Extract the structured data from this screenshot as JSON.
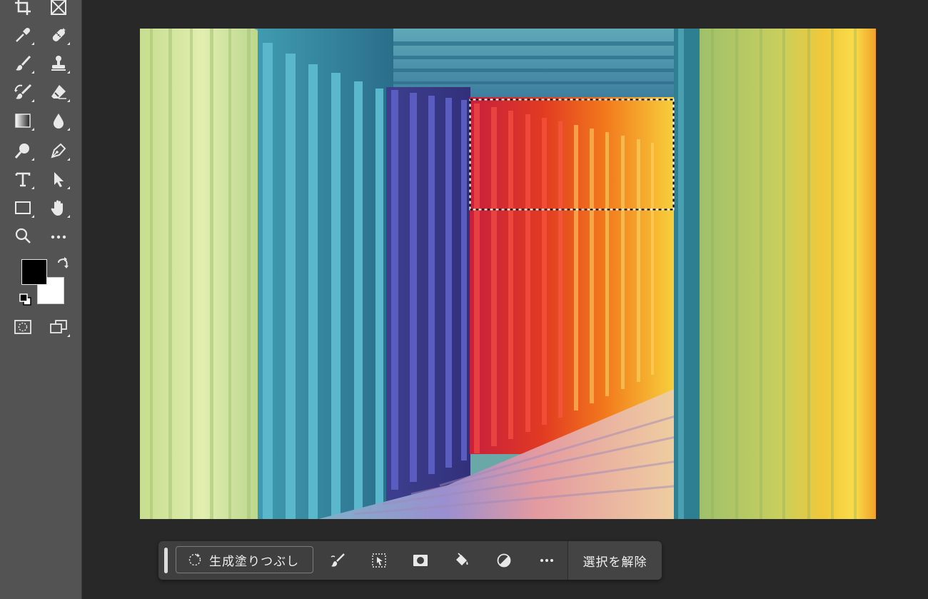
{
  "tools": [
    {
      "name": "crop-tool",
      "icon": "crop-icon"
    },
    {
      "name": "frame-tool",
      "icon": "frame-icon"
    },
    {
      "name": "eyedropper-tool",
      "icon": "eyedropper-icon"
    },
    {
      "name": "spot-healing-tool",
      "icon": "bandage-icon"
    },
    {
      "name": "brush-tool",
      "icon": "brush-icon"
    },
    {
      "name": "clone-stamp-tool",
      "icon": "stamp-icon"
    },
    {
      "name": "history-brush-tool",
      "icon": "history-brush-icon"
    },
    {
      "name": "eraser-tool",
      "icon": "eraser-icon"
    },
    {
      "name": "gradient-tool",
      "icon": "gradient-icon"
    },
    {
      "name": "blur-tool",
      "icon": "drop-icon"
    },
    {
      "name": "dodge-tool",
      "icon": "dodge-icon"
    },
    {
      "name": "pen-tool",
      "icon": "pen-icon"
    },
    {
      "name": "type-tool",
      "icon": "type-icon"
    },
    {
      "name": "path-selection-tool",
      "icon": "arrow-icon"
    },
    {
      "name": "rectangle-tool",
      "icon": "rectangle-icon"
    },
    {
      "name": "hand-tool",
      "icon": "hand-icon"
    },
    {
      "name": "zoom-tool",
      "icon": "magnifier-icon"
    },
    {
      "name": "edit-toolbar",
      "icon": "more-icon"
    }
  ],
  "colors": {
    "foreground": "#000000",
    "background": "#ffffff",
    "toolbar_bg": "#535353",
    "workspace_bg": "#282828",
    "taskbar_bg": "#3f3f3f"
  },
  "taskbar": {
    "generative_fill_label": "生成塗りつぶし",
    "deselect_label": "選択を解除",
    "icons": [
      "refine-brush-icon",
      "select-subject-icon",
      "mask-icon",
      "fill-bucket-icon",
      "adjustment-icon",
      "more-icon"
    ]
  }
}
